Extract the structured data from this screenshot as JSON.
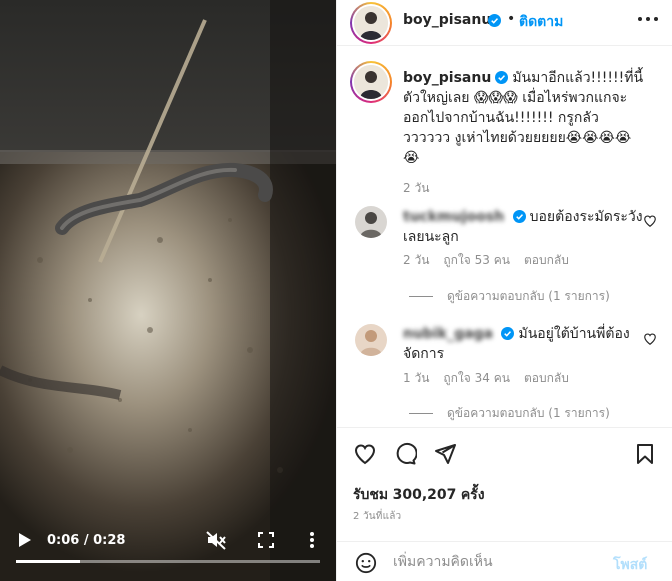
{
  "video": {
    "time_display": "0:06 / 0:28",
    "progress_fraction": 0.21,
    "icons": [
      "play-icon",
      "mute-icon",
      "fullscreen-icon",
      "more-vertical-icon"
    ]
  },
  "header": {
    "username": "boy_pisanu",
    "separator": "•",
    "follow_label": "ติดตาม"
  },
  "caption": {
    "username": "boy_pisanu",
    "text": "มันมาอีกแล้ว!!!!!!ที่นี้ตัวใหญ่เลย 😱😱😱 เมื่อไหร่พวกแกจะออกไปจากบ้านฉัน!!!!!!! กรูกลัววววววว งูเห่าไทยด้วยยยยย😭😭😭😭😭",
    "time": "2 วัน"
  },
  "comments": [
    {
      "username": "tuckmujoosh",
      "text": "บอยต้องระมัดระวังเลยนะลูก",
      "time": "2 วัน",
      "likes": "ถูกใจ 53 คน",
      "reply_label": "ตอบกลับ",
      "view_replies": "ดูข้อความตอบกลับ (1 รายการ)"
    },
    {
      "username": "nubik_gaga",
      "text": "มันอยู่ใต้บ้านพี่ต้องจัดการ",
      "time": "1 วัน",
      "likes": "ถูกใจ 34 คน",
      "reply_label": "ตอบกลับ",
      "view_replies": "ดูข้อความตอบกลับ (1 รายการ)"
    }
  ],
  "stats": {
    "views_label": "รับชม",
    "views_count": "300,207",
    "views_unit": "ครั้ง",
    "posted": "2 วันที่แล้ว"
  },
  "composer": {
    "placeholder": "เพิ่มความคิดเห็น",
    "post_label": "โพสต์"
  },
  "colors": {
    "accent": "#0095f6",
    "post_disabled": "#b2dffc",
    "muted": "#8e8e8e",
    "text": "#262626"
  }
}
